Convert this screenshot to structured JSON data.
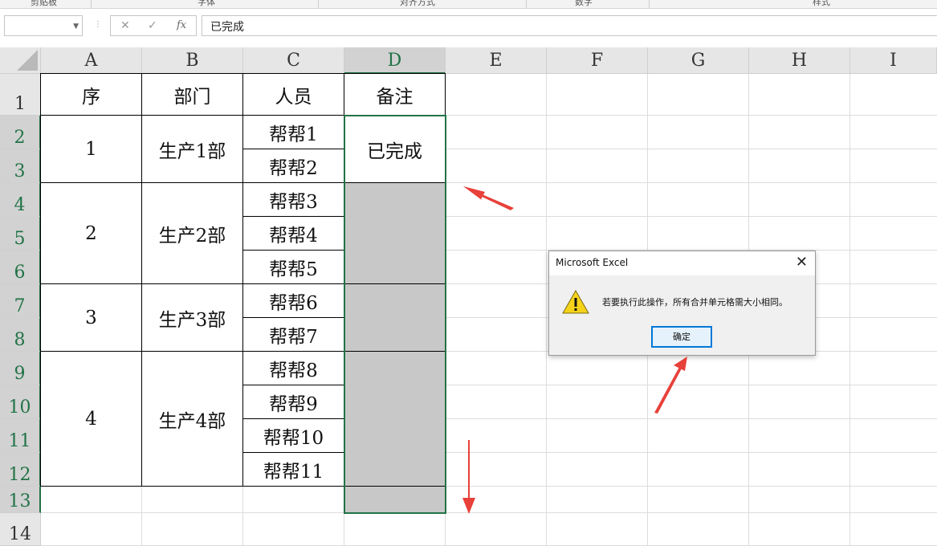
{
  "ribbon": {
    "groups": [
      "剪贴板",
      "字体",
      "对齐方式",
      "数字",
      "样式"
    ]
  },
  "formula_bar": {
    "name_box": "",
    "cancel_icon": "✕",
    "enter_icon": "✓",
    "fx_label": "fx",
    "content": "已完成"
  },
  "columns": [
    "A",
    "B",
    "C",
    "D",
    "E",
    "F",
    "G",
    "H",
    "I"
  ],
  "rows": [
    "1",
    "2",
    "3",
    "4",
    "5",
    "6",
    "7",
    "8",
    "9",
    "10",
    "11",
    "12",
    "13",
    "14"
  ],
  "selected_column": "D",
  "table": {
    "headers": [
      "序",
      "部门",
      "人员",
      "备注"
    ],
    "groups": [
      {
        "seq": "1",
        "dept": "生产1部"
      },
      {
        "seq": "2",
        "dept": "生产2部"
      },
      {
        "seq": "3",
        "dept": "生产3部"
      },
      {
        "seq": "4",
        "dept": "生产4部"
      }
    ],
    "people": [
      "帮帮1",
      "帮帮2",
      "帮帮3",
      "帮帮4",
      "帮帮5",
      "帮帮6",
      "帮帮7",
      "帮帮8",
      "帮帮9",
      "帮帮10",
      "帮帮11"
    ],
    "remark": "已完成"
  },
  "dialog": {
    "title": "Microsoft Excel",
    "message": "若要执行此操作，所有合并单元格需大小相同。",
    "ok_label": "确定",
    "icon": "warning-icon"
  },
  "colors": {
    "selection": "#217346",
    "annotation_arrow": "#e8403a",
    "merged_fill": "#c8c8c8",
    "ok_border": "#0078d7"
  }
}
